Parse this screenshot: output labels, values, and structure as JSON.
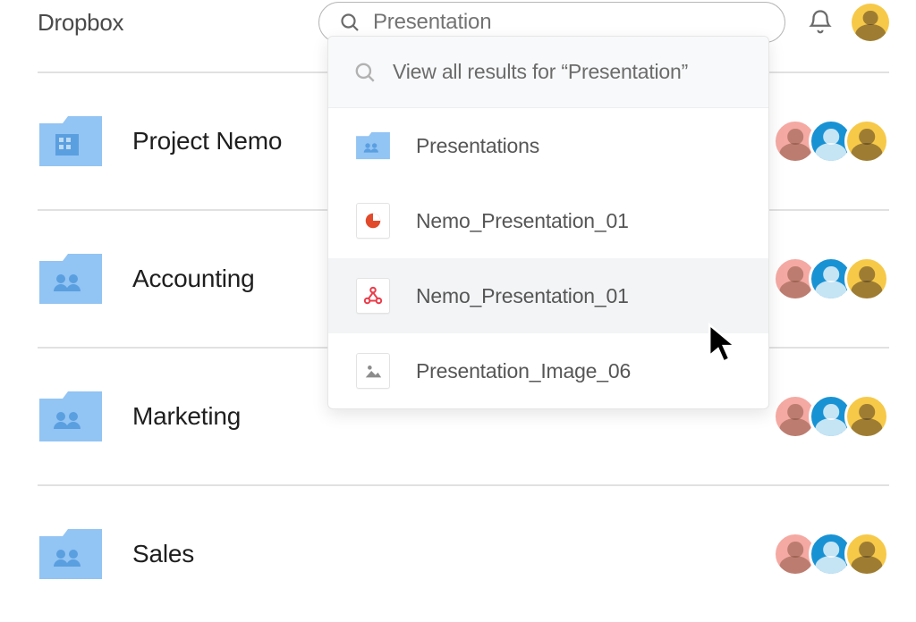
{
  "header": {
    "brand": "Dropbox",
    "search_value": "Presentation"
  },
  "search_results": {
    "header_prefix": "View all results for ",
    "header_quoted": "“Presentation”",
    "items": [
      {
        "type": "folder",
        "label": "Presentations"
      },
      {
        "type": "ppt",
        "label": "Nemo_Presentation_01"
      },
      {
        "type": "pdf",
        "label": "Nemo_Presentation_01",
        "hover": true
      },
      {
        "type": "image",
        "label": "Presentation_Image_06"
      }
    ]
  },
  "folders": [
    {
      "name": "Project Nemo",
      "icon": "org"
    },
    {
      "name": "Accounting",
      "icon": "team"
    },
    {
      "name": "Marketing",
      "icon": "team"
    },
    {
      "name": "Sales",
      "icon": "team"
    }
  ],
  "colors": {
    "folder_fill": "#92c4f4",
    "folder_fill_dark": "#7ab4ee",
    "accent_red": "#e14a2b",
    "pdf_red": "#ea3c4a",
    "icon_grey": "#8c8c8c"
  }
}
